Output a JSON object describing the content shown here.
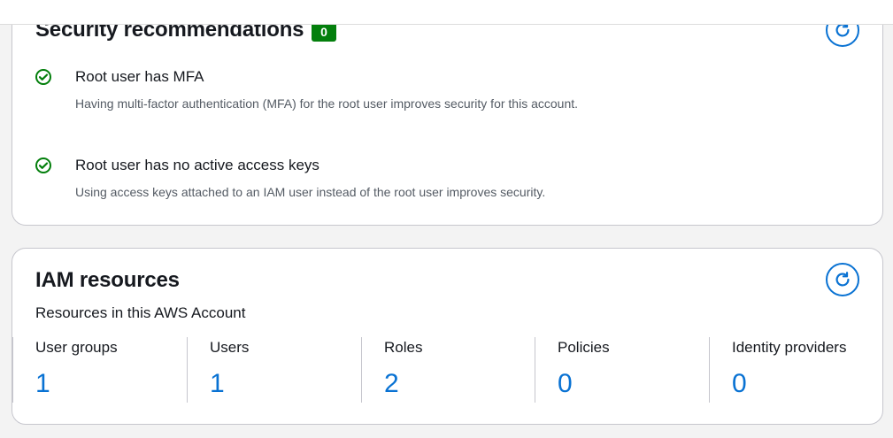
{
  "security_recommendations": {
    "title": "Security recommendations",
    "badge_count": "0",
    "refresh_icon": "refresh-icon",
    "items": [
      {
        "status": "success",
        "icon": "check-circle-icon",
        "title": "Root user has MFA",
        "description": "Having multi-factor authentication (MFA) for the root user improves security for this account."
      },
      {
        "status": "success",
        "icon": "check-circle-icon",
        "title": "Root user has no active access keys",
        "description": "Using access keys attached to an IAM user instead of the root user improves security."
      }
    ]
  },
  "iam_resources": {
    "title": "IAM resources",
    "subtitle": "Resources in this AWS Account",
    "refresh_icon": "refresh-icon",
    "metrics": [
      {
        "label": "User groups",
        "value": "1"
      },
      {
        "label": "Users",
        "value": "1"
      },
      {
        "label": "Roles",
        "value": "2"
      },
      {
        "label": "Policies",
        "value": "0"
      },
      {
        "label": "Identity providers",
        "value": "0"
      }
    ]
  },
  "colors": {
    "success": "#037f0c",
    "link": "#0972d3",
    "text": "#16191f",
    "muted": "#545b64",
    "border": "#c6c6cd",
    "page_bg": "#f3f3f3"
  }
}
